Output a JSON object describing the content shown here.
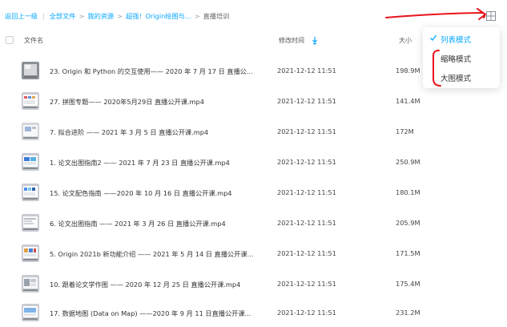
{
  "breadcrumb": {
    "back": "返回上一级",
    "items": [
      "全部文件",
      "我的资源",
      "超强！Origin绘图与..."
    ],
    "current": "直播培训"
  },
  "header": {
    "name": "文件名",
    "time": "修改时间",
    "size": "大小"
  },
  "view_menu": {
    "items": [
      {
        "label": "列表模式",
        "selected": true
      },
      {
        "label": "缩略模式",
        "selected": false
      },
      {
        "label": "大图模式",
        "selected": false
      }
    ]
  },
  "files": [
    {
      "name": "23. Origin 和 Python 的交互使用—— 2020 年 7 月 17 日 直播公...",
      "time": "2021-12-12 11:51",
      "size": "198.9M"
    },
    {
      "name": "27. 拼图专题—— 2020年5月29日 直播公开课.mp4",
      "time": "2021-12-12 11:51",
      "size": "141.4M"
    },
    {
      "name": "7. 拟合进阶 —— 2021 年 3 月 5 日 直播公开课.mp4",
      "time": "2021-12-12 11:51",
      "size": "172M"
    },
    {
      "name": "1. 论文出图指南2 —— 2021 年 7 月 23 日 直播公开课.mp4",
      "time": "2021-12-12 11:51",
      "size": "250.9M"
    },
    {
      "name": "15. 论文配色指南 ——2020 年 10 月 16 日 直播公开课.mp4",
      "time": "2021-12-12 11:51",
      "size": "180.1M"
    },
    {
      "name": "6. 论文出图指南 —— 2021 年 3 月 26 日 直播公开课.mp4",
      "time": "2021-12-12 11:51",
      "size": "205.9M"
    },
    {
      "name": "5. Origin 2021b 新功能介绍 —— 2021 年 5 月 14 日 直播公开课...",
      "time": "2021-12-12 11:51",
      "size": "171.5M"
    },
    {
      "name": "10. 跟着论文学作图 —— 2020 年 12 月 25 日 直播公开课.mp4",
      "time": "2021-12-12 11:51",
      "size": "175.4M"
    },
    {
      "name": "17. 数据地图 (Data on Map) ——2020 年 9 月 11 日直播公开课...",
      "time": "2021-12-12 11:51",
      "size": "231.2M"
    }
  ],
  "colors": {
    "link": "#06a7ff",
    "annotation": "#e8141c"
  }
}
